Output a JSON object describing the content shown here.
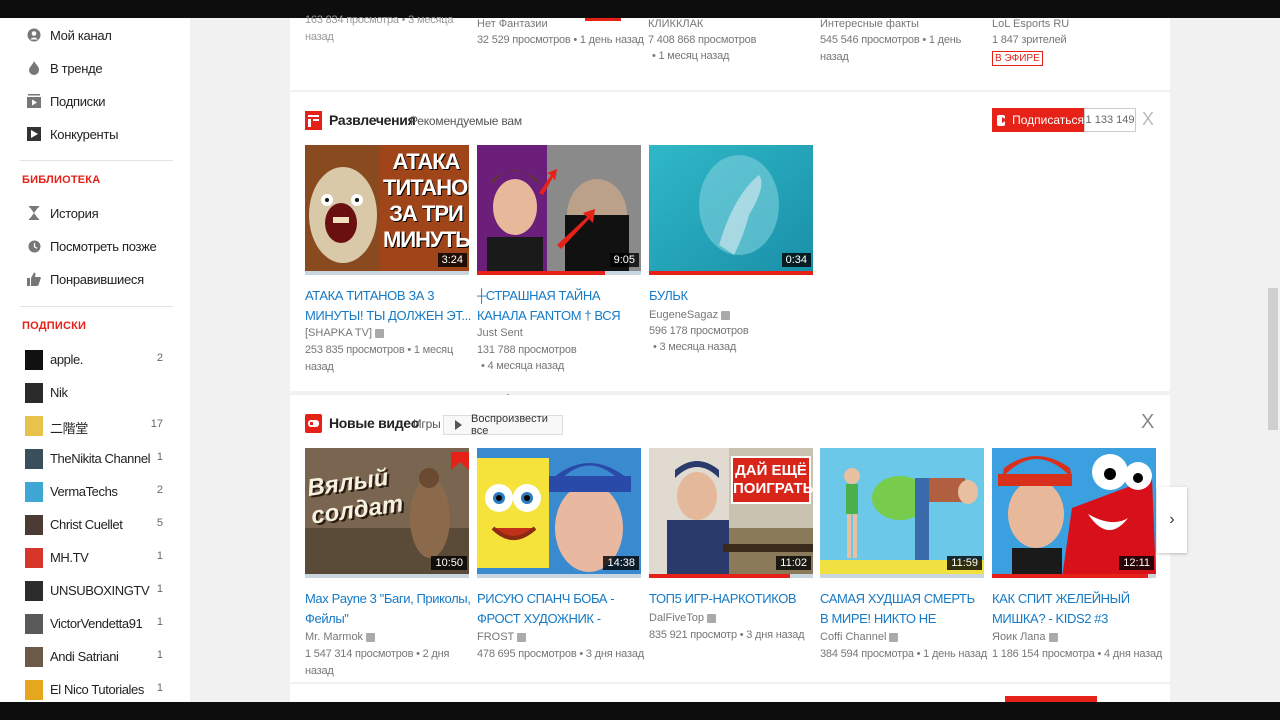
{
  "sidebar": {
    "nav": [
      {
        "label": "Мой канал",
        "icon": "account-icon"
      },
      {
        "label": "В тренде",
        "icon": "flame-icon"
      },
      {
        "label": "Подписки",
        "icon": "subscriptions-icon"
      },
      {
        "label": "Конкуренты",
        "icon": "play-icon"
      }
    ],
    "library_header": "БИБЛИОТЕКА",
    "library": [
      {
        "label": "История",
        "icon": "hourglass-icon"
      },
      {
        "label": "Посмотреть позже",
        "icon": "clock-icon"
      },
      {
        "label": "Понравившиеся",
        "icon": "thumbs-up-icon"
      }
    ],
    "subs_header": "ПОДПИСКИ",
    "subscriptions": [
      {
        "name": "apple.",
        "count": "2",
        "color": "#111111"
      },
      {
        "name": "Nik",
        "count": "",
        "color": "#2a2a2a"
      },
      {
        "name": "二階堂",
        "count": "17",
        "color": "#e8c24a"
      },
      {
        "name": "TheNikita Channel",
        "count": "1",
        "color": "#3a4f5c"
      },
      {
        "name": "VermaTechs",
        "count": "2",
        "color": "#3fa7d6"
      },
      {
        "name": "Christ Cuellet",
        "count": "5",
        "color": "#4a3b34"
      },
      {
        "name": "MH.TV",
        "count": "1",
        "color": "#d8352a"
      },
      {
        "name": "UNSUBOXINGTV",
        "count": "1",
        "color": "#2c2c2c"
      },
      {
        "name": "VictorVendetta91",
        "count": "1",
        "color": "#5a5a5a"
      },
      {
        "name": "Andi Satriani",
        "count": "1",
        "color": "#6b5a48"
      },
      {
        "name": "El Nico Tutoriales",
        "count": "1",
        "color": "#e6a71e"
      }
    ]
  },
  "top_row": [
    {
      "channel": "",
      "meta1": "",
      "meta2": ""
    },
    {
      "channel": "Нет Фантазии",
      "meta1": "32 529 просмотров • 1 день назад",
      "meta2": ""
    },
    {
      "channel": "КЛИККЛАК",
      "meta1": "7 408 868 просмотров",
      "meta2": "• 1 месяц назад"
    },
    {
      "channel": "Интересные факты",
      "meta1": "545 546 просмотров • 1 день назад",
      "meta2": ""
    },
    {
      "channel": "LoL Esports RU",
      "meta1": "1 847 зрителей",
      "meta2": "",
      "live": "В ЭФИРЕ"
    }
  ],
  "shelf1": {
    "title": "Развлечения",
    "subtitle": "Рекомендуемые вам",
    "subscribe_label": "Подписаться",
    "subscriber_count": "1 133 149",
    "close": "X",
    "videos": [
      {
        "title": "АТАКА ТИТАНОВ ЗА 3 МИНУТЫ! ТЫ ДОЛЖЕН ЭТ...",
        "channel": "[SHAPKA TV]",
        "meta1": "253 835 просмотров • 1 месяц назад",
        "meta2": "",
        "duration": "3:24",
        "progress": 0
      },
      {
        "title": "┼СТРАШНАЯ ТАЙНА КАНАЛА FANTOM † ВСЯ",
        "channel": "Just Sent",
        "meta1": "131 788 просмотров",
        "meta2": "• 4 месяца назад",
        "duration": "9:05",
        "progress": 0.78
      },
      {
        "title": "БУЛЬК",
        "channel": "EugeneSagaz",
        "meta1": "596 178 просмотров",
        "meta2": "• 3 месяца назад",
        "duration": "0:34",
        "progress": 1.0
      }
    ]
  },
  "shelf2": {
    "title": "Новые видео",
    "subtitle": "Игры",
    "play_all": "Воспроизвести все",
    "close": "X",
    "videos": [
      {
        "title": "Max Payne 3 \"Баги, Приколы, Фейлы\"",
        "channel": "Mr. Marmok",
        "meta1": "1 547 314 просмотров • 2 дня назад",
        "duration": "10:50",
        "progress": 0,
        "thumb_text": "Вялый солдат"
      },
      {
        "title": "РИСУЮ СПАНЧ БОБА - ФРОСТ ХУДОЖНИК -",
        "channel": "FROST",
        "meta1": "478 695 просмотров • 3 дня назад",
        "duration": "14:38",
        "progress": 0
      },
      {
        "title": "ТОП5 ИГР-НАРКОТИКОВ",
        "channel": "DalFiveTop",
        "meta1": "835 921 просмотр • 3 дня назад",
        "duration": "11:02",
        "progress": 0.86,
        "thumb_text": "ДАЙ ЕЩЁ ПОИГРАТЬ"
      },
      {
        "title": "САМАЯ ХУДШАЯ СМЕРТЬ В МИРЕ! НИКТО НЕ",
        "channel": "Coffi Channel",
        "meta1": "384 594 просмотра • 1 день назад",
        "duration": "11:59",
        "progress": 0
      },
      {
        "title": "КАК СПИТ ЖЕЛЕЙНЫЙ МИШКА? - KIDS2 #3",
        "channel": "Яоик Лапа",
        "meta1": "1 186 154 просмотра • 4 дня назад",
        "duration": "12:11",
        "progress": 0.95
      }
    ]
  },
  "thumb1_text": "АТАКА ТИТАНОВ ЗА ТРИ МИНУТЫ!",
  "colors": {
    "accent": "#e62117",
    "link": "#167ac6"
  }
}
